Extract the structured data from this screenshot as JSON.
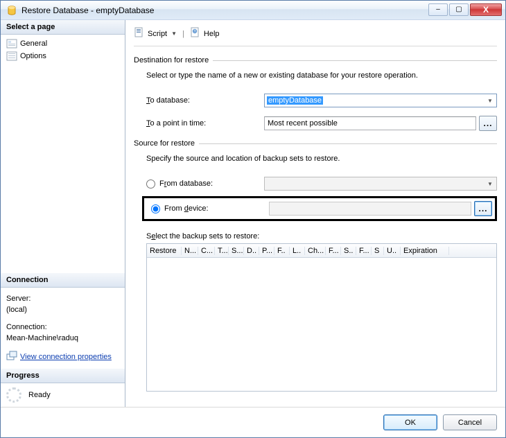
{
  "window": {
    "title": "Restore Database - emptyDatabase"
  },
  "sidebar": {
    "select_page_header": "Select a page",
    "pages": [
      {
        "label": "General"
      },
      {
        "label": "Options"
      }
    ],
    "connection_header": "Connection",
    "server_label": "Server:",
    "server_value": "(local)",
    "connection_label": "Connection:",
    "connection_value": "Mean-Machine\\raduq",
    "view_props_link": "View connection properties",
    "progress_header": "Progress",
    "progress_status": "Ready"
  },
  "toolbar": {
    "script_label": "Script",
    "help_label": "Help"
  },
  "main": {
    "destination_header": "Destination for restore",
    "destination_desc": "Select or type the name of a new or existing database for your restore operation.",
    "to_database_label": "To database:",
    "to_database_value": "emptyDatabase",
    "to_point_label": "To a point in time:",
    "to_point_value": "Most recent possible",
    "source_header": "Source for restore",
    "source_desc": "Specify the source and location of backup sets to restore.",
    "from_database_label": "From database:",
    "from_device_label": "From device:",
    "from_device_value": "",
    "browse_glyph": "...",
    "select_backup_label": "Select the backup sets to restore:",
    "grid_columns": [
      "Restore",
      "N...",
      "C...",
      "T...",
      "S...",
      "D..",
      "P...",
      "F..",
      "L..",
      "Ch...",
      "F...",
      "S..",
      "F...",
      "S",
      "U..",
      "Expiration"
    ]
  },
  "footer": {
    "ok": "OK",
    "cancel": "Cancel"
  }
}
